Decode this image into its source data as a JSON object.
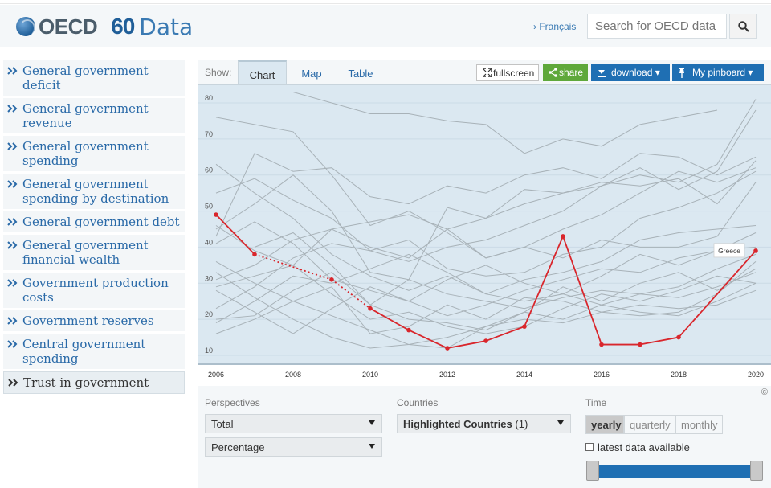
{
  "header": {
    "brand": "OECD",
    "anniversary": "60",
    "section": "Data",
    "language_link": "› Français",
    "search_placeholder": "Search for OECD data"
  },
  "sidebar": {
    "items": [
      {
        "label": "General government deficit"
      },
      {
        "label": "General government revenue"
      },
      {
        "label": "General government spending"
      },
      {
        "label": "General government spending by destination"
      },
      {
        "label": "General government debt"
      },
      {
        "label": "General government financial wealth"
      },
      {
        "label": "Government production costs"
      },
      {
        "label": "Government reserves"
      },
      {
        "label": "Central government spending"
      },
      {
        "label": "Trust in government"
      }
    ],
    "active_index": 9
  },
  "toolbar": {
    "show_label": "Show:",
    "tabs": [
      "Chart",
      "Map",
      "Table"
    ],
    "active_tab": "Chart",
    "fullscreen_label": "fullscreen",
    "share_label": "share",
    "download_label": "download ▾",
    "pinboard_label": "My pinboard ▾"
  },
  "controls": {
    "perspectives_label": "Perspectives",
    "perspective_1": "Total",
    "perspective_2": "Percentage",
    "countries_label": "Countries",
    "countries_value": "Highlighted Countries",
    "countries_count": "(1)",
    "time_label": "Time",
    "time_options": [
      "yearly",
      "quarterly",
      "monthly"
    ],
    "time_active": "yearly",
    "latest_label": "latest data available",
    "latest_checked": false,
    "copyright": "©"
  },
  "colors": {
    "highlight": "#d9262c",
    "background_lines": "#a8b2b8",
    "accent": "#1f6fb3",
    "share": "#5fa83b"
  },
  "chart_data": {
    "type": "line",
    "x_ticks": [
      "2006",
      "2008",
      "2010",
      "2012",
      "2014",
      "2016",
      "2018",
      "2020"
    ],
    "y_ticks": [
      "10",
      "20",
      "30",
      "40",
      "50",
      "60",
      "70",
      "80"
    ],
    "xlim": [
      2006,
      2020
    ],
    "ylim": [
      10,
      80
    ],
    "grid": "horizontal",
    "highlight": {
      "name": "Greece",
      "points": [
        [
          2006,
          49
        ],
        [
          2007,
          38
        ],
        [
          2009,
          31
        ],
        [
          2010,
          23
        ],
        [
          2011,
          17
        ],
        [
          2012,
          12
        ],
        [
          2013,
          14
        ],
        [
          2014,
          18
        ],
        [
          2015,
          43
        ],
        [
          2016,
          13
        ],
        [
          2017,
          13
        ],
        [
          2018,
          15
        ],
        [
          2020,
          39
        ]
      ],
      "dotted_after": [
        1,
        2
      ]
    },
    "background_series": [
      [
        [
          2006,
          31
        ],
        [
          2007,
          35
        ],
        [
          2008,
          42
        ],
        [
          2009,
          45
        ],
        [
          2010,
          40
        ],
        [
          2011,
          37
        ],
        [
          2012,
          45
        ],
        [
          2013,
          48
        ],
        [
          2014,
          52
        ],
        [
          2015,
          55
        ],
        [
          2016,
          57
        ],
        [
          2017,
          60
        ],
        [
          2018,
          58
        ],
        [
          2019,
          63
        ],
        [
          2020,
          81
        ]
      ],
      [
        [
          2006,
          55
        ],
        [
          2007,
          59
        ],
        [
          2008,
          53
        ],
        [
          2009,
          48
        ],
        [
          2010,
          39
        ],
        [
          2011,
          36
        ],
        [
          2012,
          40
        ],
        [
          2013,
          42
        ],
        [
          2014,
          46
        ],
        [
          2015,
          50
        ],
        [
          2016,
          57
        ],
        [
          2017,
          62
        ],
        [
          2018,
          56
        ],
        [
          2019,
          61
        ],
        [
          2020,
          78
        ]
      ],
      [
        [
          2006,
          45
        ],
        [
          2007,
          52
        ],
        [
          2008,
          60
        ],
        [
          2009,
          50
        ],
        [
          2010,
          33
        ],
        [
          2011,
          31
        ],
        [
          2012,
          51
        ],
        [
          2013,
          48
        ],
        [
          2014,
          56
        ],
        [
          2015,
          55
        ],
        [
          2016,
          58
        ],
        [
          2017,
          57
        ],
        [
          2018,
          59
        ],
        [
          2019,
          52
        ],
        [
          2020,
          64
        ]
      ],
      [
        [
          2006,
          29
        ],
        [
          2007,
          32
        ],
        [
          2008,
          35
        ],
        [
          2009,
          45
        ],
        [
          2010,
          47
        ],
        [
          2011,
          49
        ],
        [
          2012,
          45
        ],
        [
          2013,
          37
        ],
        [
          2014,
          40
        ],
        [
          2015,
          45
        ],
        [
          2016,
          49
        ],
        [
          2017,
          55
        ],
        [
          2018,
          61
        ],
        [
          2019,
          58
        ],
        [
          2020,
          62
        ]
      ],
      [
        [
          2006,
          23
        ],
        [
          2007,
          29
        ],
        [
          2008,
          37
        ],
        [
          2009,
          41
        ],
        [
          2010,
          39
        ],
        [
          2011,
          42
        ],
        [
          2012,
          34
        ],
        [
          2013,
          32
        ],
        [
          2014,
          33
        ],
        [
          2015,
          38
        ],
        [
          2016,
          40
        ],
        [
          2017,
          48
        ],
        [
          2018,
          51
        ],
        [
          2019,
          55
        ],
        [
          2020,
          61
        ]
      ],
      [
        [
          2006,
          19
        ],
        [
          2007,
          25
        ],
        [
          2008,
          32
        ],
        [
          2009,
          30
        ],
        [
          2010,
          34
        ],
        [
          2011,
          38
        ],
        [
          2012,
          33
        ],
        [
          2013,
          27
        ],
        [
          2014,
          31
        ],
        [
          2015,
          33
        ],
        [
          2016,
          36
        ],
        [
          2017,
          42
        ],
        [
          2018,
          44
        ],
        [
          2019,
          45
        ],
        [
          2020,
          46
        ]
      ],
      [
        [
          2006,
          41
        ],
        [
          2007,
          47
        ],
        [
          2008,
          41
        ],
        [
          2009,
          31
        ],
        [
          2010,
          28
        ],
        [
          2011,
          25
        ],
        [
          2012,
          31
        ],
        [
          2013,
          35
        ],
        [
          2014,
          30
        ],
        [
          2015,
          27
        ],
        [
          2016,
          32
        ],
        [
          2017,
          38
        ],
        [
          2018,
          35
        ],
        [
          2019,
          39
        ],
        [
          2020,
          44
        ]
      ],
      [
        [
          2006,
          28
        ],
        [
          2007,
          22
        ],
        [
          2008,
          16
        ],
        [
          2009,
          23
        ],
        [
          2010,
          29
        ],
        [
          2011,
          25
        ],
        [
          2012,
          21
        ],
        [
          2013,
          24
        ],
        [
          2014,
          28
        ],
        [
          2015,
          31
        ],
        [
          2016,
          34
        ],
        [
          2017,
          33
        ],
        [
          2018,
          37
        ],
        [
          2019,
          39
        ],
        [
          2020,
          40
        ]
      ],
      [
        [
          2006,
          20
        ],
        [
          2007,
          21
        ],
        [
          2008,
          28
        ],
        [
          2009,
          33
        ],
        [
          2010,
          24
        ],
        [
          2011,
          20
        ],
        [
          2012,
          19
        ],
        [
          2013,
          17
        ],
        [
          2014,
          22
        ],
        [
          2015,
          29
        ],
        [
          2016,
          25
        ],
        [
          2017,
          30
        ],
        [
          2018,
          33
        ],
        [
          2019,
          28
        ],
        [
          2020,
          34
        ]
      ],
      [
        [
          2006,
          46
        ],
        [
          2007,
          39
        ],
        [
          2008,
          35
        ],
        [
          2009,
          27
        ],
        [
          2010,
          20
        ],
        [
          2011,
          22
        ],
        [
          2012,
          18
        ],
        [
          2013,
          16
        ],
        [
          2014,
          18
        ],
        [
          2015,
          23
        ],
        [
          2016,
          27
        ],
        [
          2017,
          25
        ],
        [
          2018,
          28
        ],
        [
          2019,
          32
        ],
        [
          2020,
          30
        ]
      ],
      [
        [
          2006,
          36
        ],
        [
          2007,
          30
        ],
        [
          2008,
          25
        ],
        [
          2009,
          29
        ],
        [
          2010,
          16
        ],
        [
          2011,
          18
        ],
        [
          2012,
          24
        ],
        [
          2013,
          20
        ],
        [
          2014,
          26
        ],
        [
          2015,
          25
        ],
        [
          2016,
          22
        ],
        [
          2017,
          24
        ],
        [
          2018,
          23
        ],
        [
          2019,
          24
        ],
        [
          2020,
          28
        ]
      ],
      [
        [
          2006,
          33
        ],
        [
          2007,
          26
        ],
        [
          2008,
          20
        ],
        [
          2009,
          15
        ],
        [
          2010,
          12
        ],
        [
          2011,
          13
        ],
        [
          2012,
          15
        ],
        [
          2013,
          18
        ],
        [
          2014,
          22
        ],
        [
          2015,
          20
        ],
        [
          2016,
          24
        ],
        [
          2017,
          22
        ],
        [
          2018,
          21
        ],
        [
          2019,
          25
        ],
        [
          2020,
          30
        ]
      ],
      [
        [
          2006,
          43
        ],
        [
          2007,
          66
        ],
        [
          2008,
          61
        ],
        [
          2009,
          62
        ],
        [
          2010,
          54
        ],
        [
          2011,
          52
        ],
        [
          2012,
          57
        ],
        [
          2013,
          55
        ],
        [
          2014,
          60
        ],
        [
          2015,
          62
        ],
        [
          2016,
          59
        ],
        [
          2017,
          66
        ],
        [
          2018,
          65
        ],
        [
          2019,
          60
        ],
        [
          2020,
          65
        ]
      ],
      [
        [
          2008,
          83
        ],
        [
          2010,
          77
        ],
        [
          2011,
          77
        ],
        [
          2012,
          75
        ],
        [
          2013,
          74
        ],
        [
          2014,
          66
        ],
        [
          2015,
          70
        ],
        [
          2016,
          68
        ],
        [
          2017,
          74
        ],
        [
          2018,
          76
        ],
        [
          2019,
          78
        ]
      ],
      [
        [
          2006,
          76
        ],
        [
          2008,
          72
        ],
        [
          2009,
          60
        ],
        [
          2010,
          46
        ],
        [
          2011,
          50
        ],
        [
          2012,
          44
        ],
        [
          2013,
          37
        ],
        [
          2014,
          40
        ],
        [
          2015,
          37
        ],
        [
          2016,
          42
        ],
        [
          2017,
          40
        ],
        [
          2018,
          40
        ],
        [
          2019,
          43
        ],
        [
          2020,
          58
        ]
      ],
      [
        [
          2006,
          63
        ],
        [
          2007,
          55
        ],
        [
          2008,
          48
        ],
        [
          2009,
          38
        ],
        [
          2010,
          32
        ],
        [
          2011,
          28
        ],
        [
          2012,
          32
        ],
        [
          2013,
          27
        ],
        [
          2014,
          25
        ],
        [
          2015,
          27
        ],
        [
          2016,
          24
        ],
        [
          2017,
          27
        ],
        [
          2018,
          26
        ],
        [
          2019,
          29
        ],
        [
          2020,
          33
        ]
      ],
      [
        [
          2006,
          16
        ],
        [
          2007,
          20
        ],
        [
          2008,
          25
        ],
        [
          2009,
          21
        ],
        [
          2010,
          17
        ],
        [
          2011,
          13
        ],
        [
          2012,
          12
        ],
        [
          2013,
          18
        ],
        [
          2014,
          20
        ],
        [
          2015,
          19
        ],
        [
          2016,
          22
        ],
        [
          2017,
          21
        ],
        [
          2018,
          22
        ],
        [
          2019,
          27
        ],
        [
          2020,
          36
        ]
      ],
      [
        [
          2007,
          40
        ],
        [
          2008,
          44
        ],
        [
          2009,
          35
        ],
        [
          2010,
          24
        ],
        [
          2011,
          31
        ],
        [
          2012,
          27
        ],
        [
          2013,
          25
        ],
        [
          2014,
          23
        ],
        [
          2015,
          26
        ],
        [
          2016,
          28
        ],
        [
          2017,
          27
        ],
        [
          2018,
          29
        ],
        [
          2019,
          34
        ],
        [
          2020,
          38
        ]
      ]
    ]
  }
}
